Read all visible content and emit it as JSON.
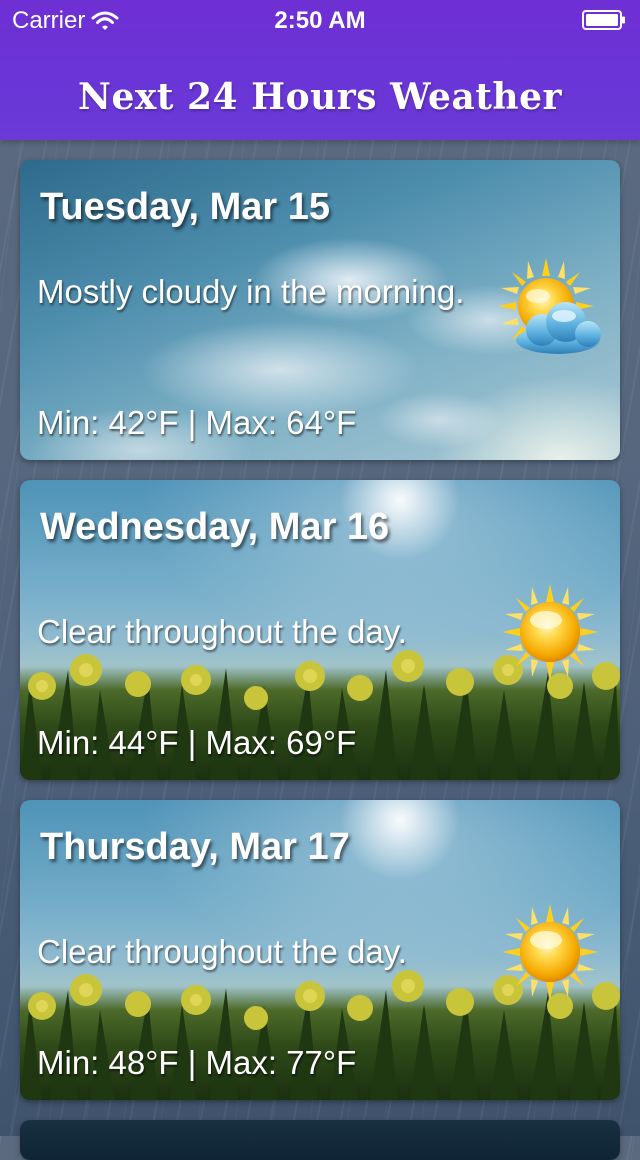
{
  "status_bar": {
    "carrier": "Carrier",
    "time": "2:50 AM",
    "wifi_icon": "wifi-icon",
    "battery_icon": "battery-icon"
  },
  "header": {
    "title": "Next 24 Hours Weather",
    "background": "#6b34d6"
  },
  "forecasts": [
    {
      "day": "Tuesday, Mar 15",
      "summary": "Mostly cloudy in the morning.",
      "temps": "Min: 42°F | Max: 64°F",
      "icon": "partly-cloudy-icon",
      "background": "cloudy-sky"
    },
    {
      "day": "Wednesday, Mar 16",
      "summary": "Clear throughout the day.",
      "temps": "Min: 44°F | Max: 69°F",
      "icon": "sun-icon",
      "background": "sunny-daffodils"
    },
    {
      "day": "Thursday, Mar 17",
      "summary": "Clear throughout the day.",
      "temps": "Min: 48°F | Max: 77°F",
      "icon": "sun-icon",
      "background": "sunny-daffodils"
    }
  ]
}
